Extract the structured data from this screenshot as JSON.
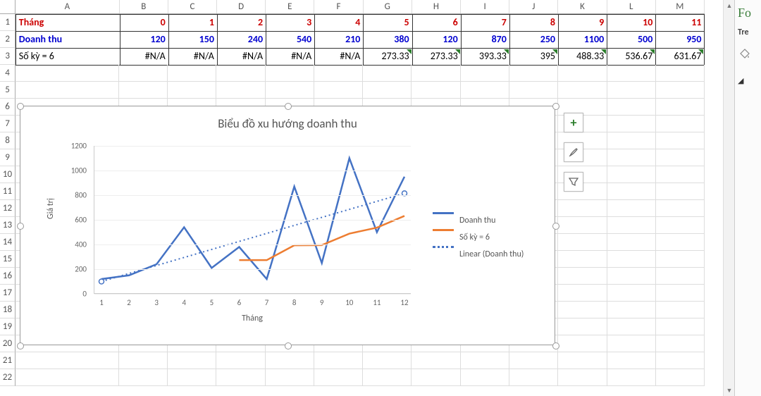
{
  "columns": [
    "A",
    "B",
    "C",
    "D",
    "E",
    "F",
    "G",
    "H",
    "I",
    "J",
    "K",
    "L",
    "M"
  ],
  "rows_visible": 22,
  "data_rows": [
    {
      "header": "Tháng",
      "style": "red",
      "vstyle": "red",
      "values": [
        "0",
        "1",
        "2",
        "3",
        "4",
        "5",
        "6",
        "7",
        "8",
        "9",
        "10",
        "11"
      ]
    },
    {
      "header": "Doanh thu",
      "style": "blue",
      "vstyle": "blue",
      "values": [
        "120",
        "150",
        "240",
        "540",
        "210",
        "380",
        "120",
        "870",
        "250",
        "1100",
        "500",
        "950"
      ]
    },
    {
      "header": "Số kỳ = 6",
      "style": "",
      "vstyle": "",
      "tri_from": 5,
      "values": [
        "#N/A",
        "#N/A",
        "#N/A",
        "#N/A",
        "#N/A",
        "273.33",
        "273.33",
        "393.33",
        "395",
        "488.33",
        "536.67",
        "631.67"
      ]
    }
  ],
  "chart": {
    "title": "Biểu đồ xu hướng doanh thu",
    "ylabel": "Giá trị",
    "xlabel": "Tháng",
    "side_pane": {
      "header": "Fo",
      "sub": "Tre"
    }
  },
  "legend": [
    "Doanh thu",
    "Số kỳ = 6",
    "Linear (Doanh thu)"
  ],
  "icons": {
    "plus": "+",
    "brush": "brush",
    "filter": "filter"
  },
  "chart_data": {
    "type": "line",
    "categories": [
      1,
      2,
      3,
      4,
      5,
      6,
      7,
      8,
      9,
      10,
      11,
      12
    ],
    "xlabel": "Tháng",
    "ylabel": "Giá trị",
    "title": "Biểu đồ xu hướng doanh thu",
    "ylim": [
      0,
      1200
    ],
    "yticks": [
      0,
      200,
      400,
      600,
      800,
      1000,
      1200
    ],
    "series": [
      {
        "name": "Doanh thu",
        "color": "#4472c4",
        "values": [
          120,
          150,
          240,
          540,
          210,
          380,
          120,
          870,
          250,
          1100,
          500,
          950
        ]
      },
      {
        "name": "Số kỳ = 6",
        "color": "#ed7d31",
        "values": [
          null,
          null,
          null,
          null,
          null,
          273.33,
          273.33,
          393.33,
          395,
          488.33,
          536.67,
          631.67
        ]
      },
      {
        "name": "Linear (Doanh thu)",
        "color": "#4472c4",
        "style": "dotted",
        "trend_of": "Doanh thu",
        "endpoints": [
          {
            "x": 1,
            "y": 100
          },
          {
            "x": 12,
            "y": 815
          }
        ]
      }
    ]
  }
}
